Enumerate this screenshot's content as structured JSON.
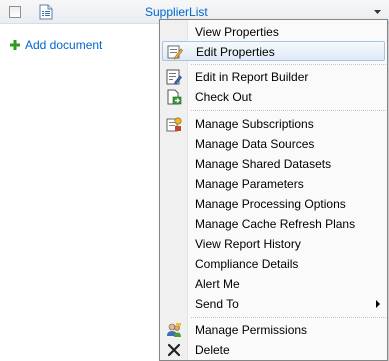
{
  "item": {
    "title": "SupplierList"
  },
  "add_document": "Add document",
  "menu": {
    "view_properties": "View Properties",
    "edit_properties": "Edit Properties",
    "edit_report_builder": "Edit in Report Builder",
    "check_out": "Check Out",
    "manage_subscriptions": "Manage Subscriptions",
    "manage_data_sources": "Manage Data Sources",
    "manage_shared_datasets": "Manage Shared Datasets",
    "manage_parameters": "Manage Parameters",
    "manage_processing_options": "Manage Processing Options",
    "manage_cache_refresh_plans": "Manage Cache Refresh Plans",
    "view_report_history": "View Report History",
    "compliance_details": "Compliance Details",
    "alert_me": "Alert Me",
    "send_to": "Send To",
    "manage_permissions": "Manage Permissions",
    "delete": "Delete"
  },
  "colors": {
    "link": "#0066cc",
    "hover_border": "#a8c4e6",
    "menu_border": "#868686"
  }
}
